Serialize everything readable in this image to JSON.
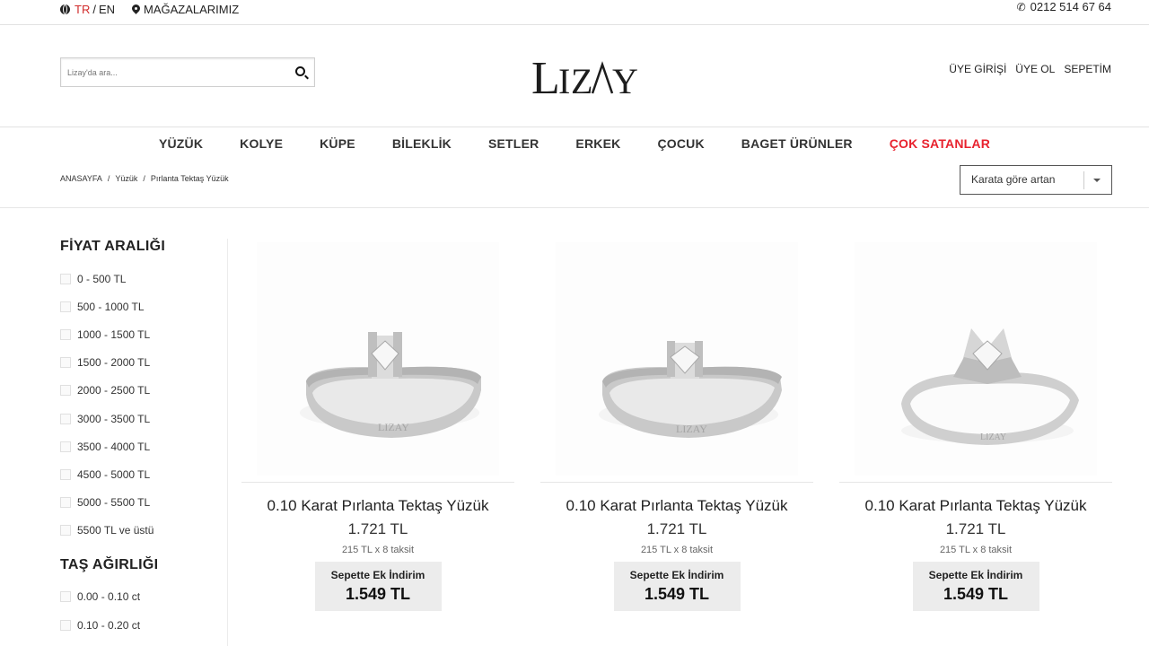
{
  "topbar": {
    "lang_tr": "TR",
    "lang_sep": "/",
    "lang_en": "EN",
    "stores": "MAĞAZALARIMIZ",
    "phone": "0212 514 67 64"
  },
  "header": {
    "search_placeholder": "Lizay'da ara...",
    "logo": "LIZAY",
    "login": "ÜYE GİRİŞİ",
    "register": "ÜYE OL",
    "cart": "SEPETİM"
  },
  "nav": [
    "YÜZÜK",
    "KOLYE",
    "KÜPE",
    "BİLEKLİK",
    "SETLER",
    "ERKEK",
    "ÇOCUK",
    "BAGET ÜRÜNLER",
    "ÇOK SATANLAR"
  ],
  "breadcrumb": [
    "ANASAYFA",
    "Yüzük",
    "Pırlanta Tektaş Yüzük"
  ],
  "sort": {
    "selected": "Karata göre artan"
  },
  "sidebar": {
    "price_title": "FİYAT ARALIĞI",
    "price_ranges": [
      "0 - 500 TL",
      "500 - 1000 TL",
      "1000 - 1500 TL",
      "1500 - 2000 TL",
      "2000 - 2500 TL",
      "3000 - 3500 TL",
      "3500 - 4000 TL",
      "4500 - 5000 TL",
      "5000 - 5500 TL",
      "5500 TL ve üstü"
    ],
    "weight_title": "TAŞ AĞIRLIĞI",
    "weights": [
      "0.00 - 0.10 ct",
      "0.10 - 0.20 ct"
    ]
  },
  "products": [
    {
      "name": "0.10 Karat Pırlanta Tektaş Yüzük",
      "price": "1.721 TL",
      "installment": "215 TL x 8 taksit",
      "discount_label": "Sepette Ek İndirim",
      "discount_price": "1.549 TL",
      "engraving": "LIZAY"
    },
    {
      "name": "0.10 Karat Pırlanta Tektaş Yüzük",
      "price": "1.721 TL",
      "installment": "215 TL x 8 taksit",
      "discount_label": "Sepette Ek İndirim",
      "discount_price": "1.549 TL",
      "engraving": "LIZAY"
    },
    {
      "name": "0.10 Karat Pırlanta Tektaş Yüzük",
      "price": "1.721 TL",
      "installment": "215 TL x 8 taksit",
      "discount_label": "Sepette Ek İndirim",
      "discount_price": "1.549 TL",
      "engraving": "LIZAY"
    }
  ],
  "colors": {
    "accent": "#e8222e",
    "lang_active": "#d12b2b",
    "discount_bg": "#ececec"
  }
}
